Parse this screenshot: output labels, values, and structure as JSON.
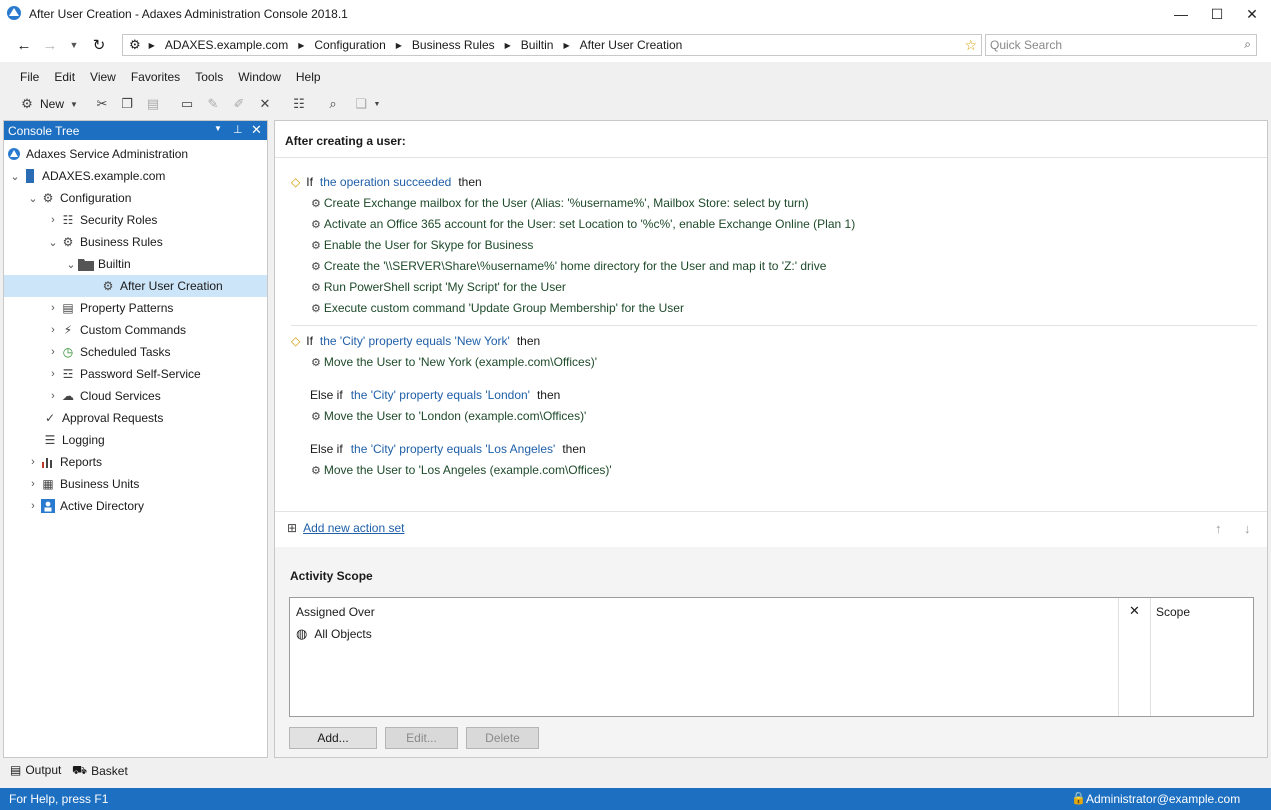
{
  "window": {
    "title": "After User Creation - Adaxes Administration Console 2018.1",
    "minimize": "—",
    "maximize": "☐",
    "close": "✕"
  },
  "nav": {
    "breadcrumbs": [
      "ADAXES.example.com",
      "Configuration",
      "Business Rules",
      "Builtin",
      "After User Creation"
    ],
    "search_placeholder": "Quick Search"
  },
  "menu": [
    "File",
    "Edit",
    "View",
    "Favorites",
    "Tools",
    "Window",
    "Help"
  ],
  "toolbar": {
    "new_label": "New"
  },
  "tree": {
    "title": "Console Tree",
    "items": [
      {
        "label": "Adaxes Service Administration"
      },
      {
        "label": "ADAXES.example.com"
      },
      {
        "label": "Configuration"
      },
      {
        "label": "Security Roles"
      },
      {
        "label": "Business Rules"
      },
      {
        "label": "Builtin"
      },
      {
        "label": "After User Creation"
      },
      {
        "label": "Property Patterns"
      },
      {
        "label": "Custom Commands"
      },
      {
        "label": "Scheduled Tasks"
      },
      {
        "label": "Password Self-Service"
      },
      {
        "label": "Cloud Services"
      },
      {
        "label": "Approval Requests"
      },
      {
        "label": "Logging"
      },
      {
        "label": "Reports"
      },
      {
        "label": "Business Units"
      },
      {
        "label": "Active Directory"
      }
    ]
  },
  "rule": {
    "heading": "After creating a user:",
    "if": "If",
    "else_if": "Else if",
    "then": "then",
    "set1": {
      "condition": "the operation succeeded",
      "actions": [
        "Create Exchange mailbox for the User (Alias: '%username%', Mailbox Store: select by turn)",
        "Activate an Office 365 account for the User: set Location to '%c%', enable Exchange Online (Plan 1)",
        "Enable the User for Skype for Business",
        "Create the '\\\\SERVER\\Share\\%username%' home directory for the User and map it to 'Z:' drive",
        "Run PowerShell script 'My Script' for the User",
        "Execute custom command 'Update Group Membership' for the User"
      ]
    },
    "set2": {
      "cond1": "the 'City' property equals 'New York'",
      "act1": "Move the User to 'New York (example.com\\Offices)'",
      "cond2": "the 'City' property equals 'London'",
      "act2": "Move the User to 'London (example.com\\Offices)'",
      "cond3": "the 'City' property equals 'Los Angeles'",
      "act3": "Move the User to 'Los Angeles (example.com\\Offices)'"
    },
    "add_action_set": "Add new action set"
  },
  "scope": {
    "title": "Activity Scope",
    "col_assigned": "Assigned Over",
    "col_scope": "Scope",
    "row_all": "All Objects",
    "add": "Add...",
    "edit": "Edit...",
    "delete": "Delete"
  },
  "bottom": {
    "output": "Output",
    "basket": "Basket"
  },
  "status": {
    "help": "For Help, press F1",
    "user": "Administrator@example.com"
  }
}
